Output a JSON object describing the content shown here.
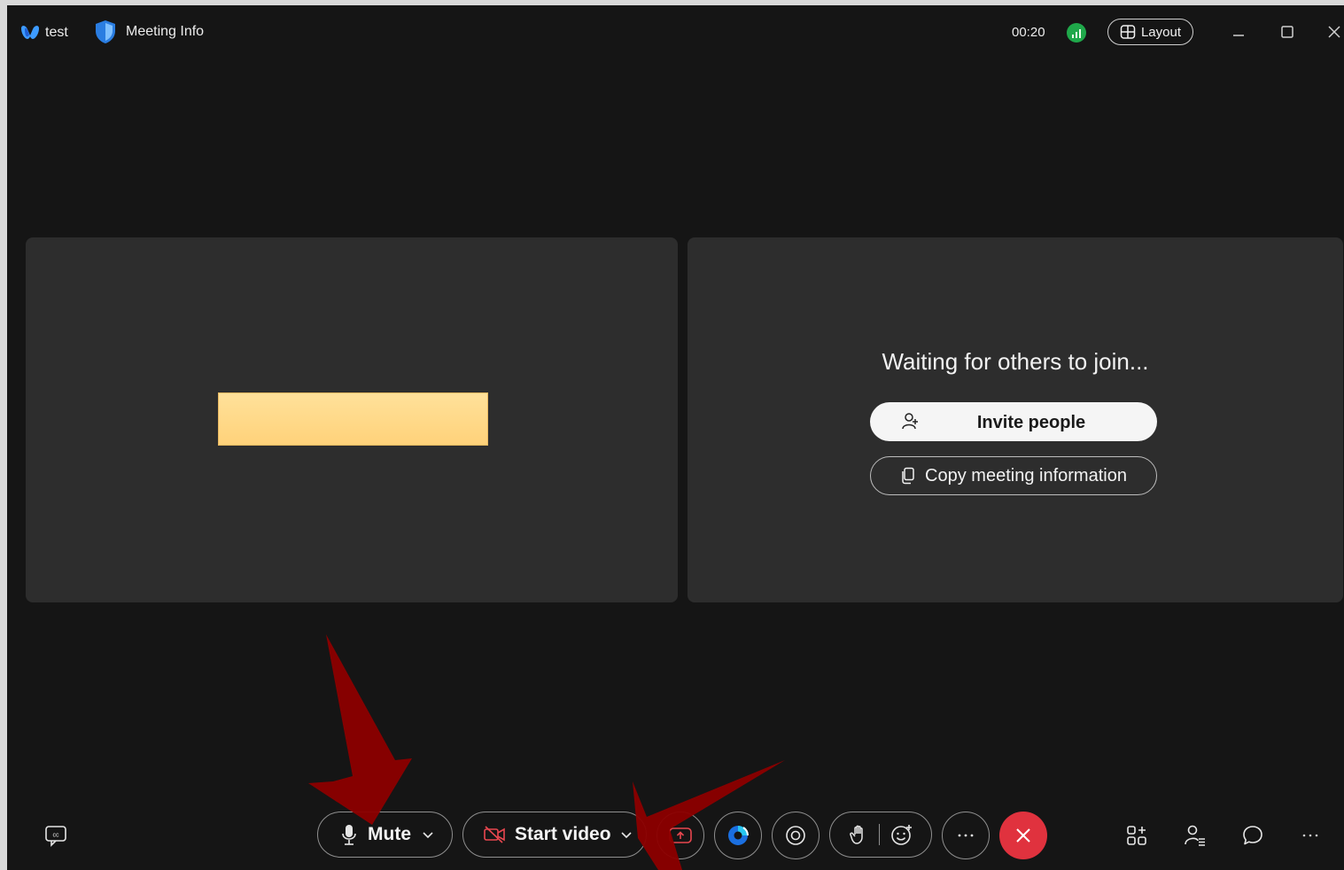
{
  "titlebar": {
    "app_name": "test",
    "meeting_info_label": "Meeting Info",
    "timer": "00:20",
    "layout_label": "Layout"
  },
  "stage": {
    "waiting_text": "Waiting for others to join...",
    "invite_label": "Invite people",
    "copy_label": "Copy meeting information"
  },
  "toolbar": {
    "mute_label": "Mute",
    "start_video_label": "Start video"
  },
  "icons": {
    "app_logo": "webex-logo-icon",
    "meeting_info": "shield-icon",
    "signal": "network-signal-icon",
    "layout": "grid-layout-icon",
    "captions": "closed-captions-icon",
    "share": "share-screen-icon",
    "ai": "ai-assistant-icon",
    "record": "record-icon",
    "raise_hand": "raise-hand-icon",
    "reaction": "reaction-icon",
    "more": "more-icon",
    "end": "end-call-icon",
    "apps": "apps-icon",
    "participants": "participants-icon",
    "chat": "chat-icon"
  },
  "colors": {
    "background": "#151515",
    "tile": "#2d2d2d",
    "end_call": "#e0323e",
    "signal_good": "#1fa84a",
    "redaction": "#ffd98a",
    "annotation_arrow": "#8b0000"
  }
}
